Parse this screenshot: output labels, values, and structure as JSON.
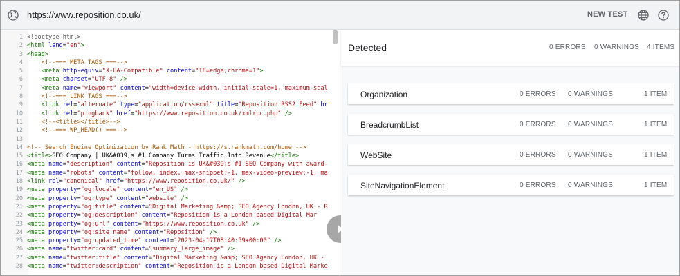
{
  "topbar": {
    "url": "https://www.reposition.co.uk/",
    "new_test_label": "NEW TEST",
    "icons": [
      "globe-icon",
      "language-icon",
      "help-icon"
    ]
  },
  "code": {
    "lines": [
      {
        "n": "1",
        "t": [
          {
            "c": "doc",
            "v": "<!doctype html>"
          }
        ]
      },
      {
        "n": "2",
        "t": [
          {
            "c": "tag",
            "v": "<html "
          },
          {
            "c": "attr",
            "v": "lang"
          },
          {
            "c": "txt",
            "v": "="
          },
          {
            "c": "str",
            "v": "\"en\""
          },
          {
            "c": "tag",
            "v": ">"
          }
        ]
      },
      {
        "n": "3",
        "t": [
          {
            "c": "tag",
            "v": "<head>"
          }
        ]
      },
      {
        "n": "4",
        "t": [
          {
            "c": "txt",
            "v": "    "
          },
          {
            "c": "com",
            "v": "<!--=== META TAGS ===-->"
          }
        ]
      },
      {
        "n": "5",
        "t": [
          {
            "c": "txt",
            "v": "    "
          },
          {
            "c": "tag",
            "v": "<meta "
          },
          {
            "c": "attr",
            "v": "http-equiv"
          },
          {
            "c": "txt",
            "v": "="
          },
          {
            "c": "str",
            "v": "\"X-UA-Compatible\""
          },
          {
            "c": "txt",
            "v": " "
          },
          {
            "c": "attr",
            "v": "content"
          },
          {
            "c": "txt",
            "v": "="
          },
          {
            "c": "str",
            "v": "\"IE=edge,chrome=1\""
          },
          {
            "c": "tag",
            "v": ">"
          }
        ]
      },
      {
        "n": "6",
        "t": [
          {
            "c": "txt",
            "v": "    "
          },
          {
            "c": "tag",
            "v": "<meta "
          },
          {
            "c": "attr",
            "v": "charset"
          },
          {
            "c": "txt",
            "v": "="
          },
          {
            "c": "str",
            "v": "\"UTF-8\""
          },
          {
            "c": "tag",
            "v": " />"
          }
        ]
      },
      {
        "n": "7",
        "t": [
          {
            "c": "txt",
            "v": "    "
          },
          {
            "c": "tag",
            "v": "<meta "
          },
          {
            "c": "attr",
            "v": "name"
          },
          {
            "c": "txt",
            "v": "="
          },
          {
            "c": "str",
            "v": "\"viewport\""
          },
          {
            "c": "txt",
            "v": " "
          },
          {
            "c": "attr",
            "v": "content"
          },
          {
            "c": "txt",
            "v": "="
          },
          {
            "c": "str",
            "v": "\"width=device-width, initial-scale=1, maximum-scal"
          }
        ]
      },
      {
        "n": "8",
        "t": [
          {
            "c": "txt",
            "v": "    "
          },
          {
            "c": "com",
            "v": "<!--=== LINK TAGS ===-->"
          }
        ]
      },
      {
        "n": "9",
        "t": [
          {
            "c": "txt",
            "v": "    "
          },
          {
            "c": "tag",
            "v": "<link "
          },
          {
            "c": "attr",
            "v": "rel"
          },
          {
            "c": "txt",
            "v": "="
          },
          {
            "c": "str",
            "v": "\"alternate\""
          },
          {
            "c": "txt",
            "v": " "
          },
          {
            "c": "attr",
            "v": "type"
          },
          {
            "c": "txt",
            "v": "="
          },
          {
            "c": "str",
            "v": "\"application/rss+xml\""
          },
          {
            "c": "txt",
            "v": " "
          },
          {
            "c": "attr",
            "v": "title"
          },
          {
            "c": "txt",
            "v": "="
          },
          {
            "c": "str",
            "v": "\"Reposition RSS2 Feed\""
          },
          {
            "c": "txt",
            "v": " "
          },
          {
            "c": "attr",
            "v": "hr"
          }
        ]
      },
      {
        "n": "10",
        "t": [
          {
            "c": "txt",
            "v": "    "
          },
          {
            "c": "tag",
            "v": "<link "
          },
          {
            "c": "attr",
            "v": "rel"
          },
          {
            "c": "txt",
            "v": "="
          },
          {
            "c": "str",
            "v": "\"pingback\""
          },
          {
            "c": "txt",
            "v": " "
          },
          {
            "c": "attr",
            "v": "href"
          },
          {
            "c": "txt",
            "v": "="
          },
          {
            "c": "str",
            "v": "\"https://www.reposition.co.uk/xmlrpc.php\""
          },
          {
            "c": "tag",
            "v": " />"
          }
        ]
      },
      {
        "n": "11",
        "t": [
          {
            "c": "txt",
            "v": "    "
          },
          {
            "c": "com",
            "v": "<!--<title></title>-->"
          }
        ]
      },
      {
        "n": "12",
        "t": [
          {
            "c": "txt",
            "v": "    "
          },
          {
            "c": "com",
            "v": "<!--=== WP_HEAD() ===-->"
          }
        ]
      },
      {
        "n": "13",
        "t": [
          {
            "c": "txt",
            "v": ""
          }
        ]
      },
      {
        "n": "14",
        "t": [
          {
            "c": "com",
            "v": "<!-- Search Engine Optimization by Rank Math - https://s.rankmath.com/home -->"
          }
        ]
      },
      {
        "n": "15",
        "t": [
          {
            "c": "tag",
            "v": "<title>"
          },
          {
            "c": "txt",
            "v": "SEO Company | UK&#039;s #1 Company Turns Traffic Into Revenue"
          },
          {
            "c": "tag",
            "v": "</title>"
          }
        ]
      },
      {
        "n": "16",
        "t": [
          {
            "c": "tag",
            "v": "<meta "
          },
          {
            "c": "attr",
            "v": "name"
          },
          {
            "c": "txt",
            "v": "="
          },
          {
            "c": "str",
            "v": "\"description\""
          },
          {
            "c": "txt",
            "v": " "
          },
          {
            "c": "attr",
            "v": "content"
          },
          {
            "c": "txt",
            "v": "="
          },
          {
            "c": "str",
            "v": "\"Reposition is UK&#039;s #1 SEO Company with award-"
          }
        ]
      },
      {
        "n": "17",
        "t": [
          {
            "c": "tag",
            "v": "<meta "
          },
          {
            "c": "attr",
            "v": "name"
          },
          {
            "c": "txt",
            "v": "="
          },
          {
            "c": "str",
            "v": "\"robots\""
          },
          {
            "c": "txt",
            "v": " "
          },
          {
            "c": "attr",
            "v": "content"
          },
          {
            "c": "txt",
            "v": "="
          },
          {
            "c": "str",
            "v": "\"follow, index, max-snippet:-1, max-video-preview:-1, ma"
          }
        ]
      },
      {
        "n": "18",
        "t": [
          {
            "c": "tag",
            "v": "<link "
          },
          {
            "c": "attr",
            "v": "rel"
          },
          {
            "c": "txt",
            "v": "="
          },
          {
            "c": "str",
            "v": "\"canonical\""
          },
          {
            "c": "txt",
            "v": " "
          },
          {
            "c": "attr",
            "v": "href"
          },
          {
            "c": "txt",
            "v": "="
          },
          {
            "c": "str",
            "v": "\"https://www.reposition.co.uk/\""
          },
          {
            "c": "tag",
            "v": " />"
          }
        ]
      },
      {
        "n": "19",
        "t": [
          {
            "c": "tag",
            "v": "<meta "
          },
          {
            "c": "attr",
            "v": "property"
          },
          {
            "c": "txt",
            "v": "="
          },
          {
            "c": "str",
            "v": "\"og:locale\""
          },
          {
            "c": "txt",
            "v": " "
          },
          {
            "c": "attr",
            "v": "content"
          },
          {
            "c": "txt",
            "v": "="
          },
          {
            "c": "str",
            "v": "\"en_US\""
          },
          {
            "c": "tag",
            "v": " />"
          }
        ]
      },
      {
        "n": "20",
        "t": [
          {
            "c": "tag",
            "v": "<meta "
          },
          {
            "c": "attr",
            "v": "property"
          },
          {
            "c": "txt",
            "v": "="
          },
          {
            "c": "str",
            "v": "\"og:type\""
          },
          {
            "c": "txt",
            "v": " "
          },
          {
            "c": "attr",
            "v": "content"
          },
          {
            "c": "txt",
            "v": "="
          },
          {
            "c": "str",
            "v": "\"website\""
          },
          {
            "c": "tag",
            "v": " />"
          }
        ]
      },
      {
        "n": "21",
        "t": [
          {
            "c": "tag",
            "v": "<meta "
          },
          {
            "c": "attr",
            "v": "property"
          },
          {
            "c": "txt",
            "v": "="
          },
          {
            "c": "str",
            "v": "\"og:title\""
          },
          {
            "c": "txt",
            "v": " "
          },
          {
            "c": "attr",
            "v": "content"
          },
          {
            "c": "txt",
            "v": "="
          },
          {
            "c": "str",
            "v": "\"Digital Marketing &amp; SEO Agency London, UK - R"
          }
        ]
      },
      {
        "n": "22",
        "t": [
          {
            "c": "tag",
            "v": "<meta "
          },
          {
            "c": "attr",
            "v": "property"
          },
          {
            "c": "txt",
            "v": "="
          },
          {
            "c": "str",
            "v": "\"og:description\""
          },
          {
            "c": "txt",
            "v": " "
          },
          {
            "c": "attr",
            "v": "content"
          },
          {
            "c": "txt",
            "v": "="
          },
          {
            "c": "str",
            "v": "\"Reposition is a London based Digital Mar"
          }
        ]
      },
      {
        "n": "23",
        "t": [
          {
            "c": "tag",
            "v": "<meta "
          },
          {
            "c": "attr",
            "v": "property"
          },
          {
            "c": "txt",
            "v": "="
          },
          {
            "c": "str",
            "v": "\"og:url\""
          },
          {
            "c": "txt",
            "v": " "
          },
          {
            "c": "attr",
            "v": "content"
          },
          {
            "c": "txt",
            "v": "="
          },
          {
            "c": "str",
            "v": "\"https://www.reposition.co.uk\""
          },
          {
            "c": "tag",
            "v": " />"
          }
        ]
      },
      {
        "n": "24",
        "t": [
          {
            "c": "tag",
            "v": "<meta "
          },
          {
            "c": "attr",
            "v": "property"
          },
          {
            "c": "txt",
            "v": "="
          },
          {
            "c": "str",
            "v": "\"og:site_name\""
          },
          {
            "c": "txt",
            "v": " "
          },
          {
            "c": "attr",
            "v": "content"
          },
          {
            "c": "txt",
            "v": "="
          },
          {
            "c": "str",
            "v": "\"Reposition\""
          },
          {
            "c": "tag",
            "v": " />"
          }
        ]
      },
      {
        "n": "25",
        "t": [
          {
            "c": "tag",
            "v": "<meta "
          },
          {
            "c": "attr",
            "v": "property"
          },
          {
            "c": "txt",
            "v": "="
          },
          {
            "c": "str",
            "v": "\"og:updated_time\""
          },
          {
            "c": "txt",
            "v": " "
          },
          {
            "c": "attr",
            "v": "content"
          },
          {
            "c": "txt",
            "v": "="
          },
          {
            "c": "str",
            "v": "\"2023-04-17T08:40:59+00:00\""
          },
          {
            "c": "tag",
            "v": " />"
          }
        ]
      },
      {
        "n": "26",
        "t": [
          {
            "c": "tag",
            "v": "<meta "
          },
          {
            "c": "attr",
            "v": "name"
          },
          {
            "c": "txt",
            "v": "="
          },
          {
            "c": "str",
            "v": "\"twitter:card\""
          },
          {
            "c": "txt",
            "v": " "
          },
          {
            "c": "attr",
            "v": "content"
          },
          {
            "c": "txt",
            "v": "="
          },
          {
            "c": "str",
            "v": "\"summary_large_image\""
          },
          {
            "c": "tag",
            "v": " />"
          }
        ]
      },
      {
        "n": "27",
        "t": [
          {
            "c": "tag",
            "v": "<meta "
          },
          {
            "c": "attr",
            "v": "name"
          },
          {
            "c": "txt",
            "v": "="
          },
          {
            "c": "str",
            "v": "\"twitter:title\""
          },
          {
            "c": "txt",
            "v": " "
          },
          {
            "c": "attr",
            "v": "content"
          },
          {
            "c": "txt",
            "v": "="
          },
          {
            "c": "str",
            "v": "\"Digital Marketing &amp; SEO Agency London, UK -"
          }
        ]
      },
      {
        "n": "28",
        "t": [
          {
            "c": "tag",
            "v": "<meta "
          },
          {
            "c": "attr",
            "v": "name"
          },
          {
            "c": "txt",
            "v": "="
          },
          {
            "c": "str",
            "v": "\"twitter:description\""
          },
          {
            "c": "txt",
            "v": " "
          },
          {
            "c": "attr",
            "v": "content"
          },
          {
            "c": "txt",
            "v": "="
          },
          {
            "c": "str",
            "v": "\"Reposition is a London based Digital Marke"
          }
        ]
      }
    ]
  },
  "results": {
    "title": "Detected",
    "errors": "0 ERRORS",
    "warnings": "0 WARNINGS",
    "items": "4 ITEMS",
    "cards": [
      {
        "name": "Organization",
        "errors": "0 ERRORS",
        "warnings": "0 WARNINGS",
        "items": "1 ITEM"
      },
      {
        "name": "BreadcrumbList",
        "errors": "0 ERRORS",
        "warnings": "0 WARNINGS",
        "items": "1 ITEM"
      },
      {
        "name": "WebSite",
        "errors": "0 ERRORS",
        "warnings": "0 WARNINGS",
        "items": "1 ITEM"
      },
      {
        "name": "SiteNavigationElement",
        "errors": "0 ERRORS",
        "warnings": "0 WARNINGS",
        "items": "1 ITEM"
      }
    ]
  },
  "colors": {
    "topbar_bg": "#f1f3f4",
    "results_bg": "#f8f9fa",
    "code_tag": "#117700",
    "code_attr": "#0000cc",
    "code_string": "#aa1111",
    "code_comment": "#aa5500"
  }
}
